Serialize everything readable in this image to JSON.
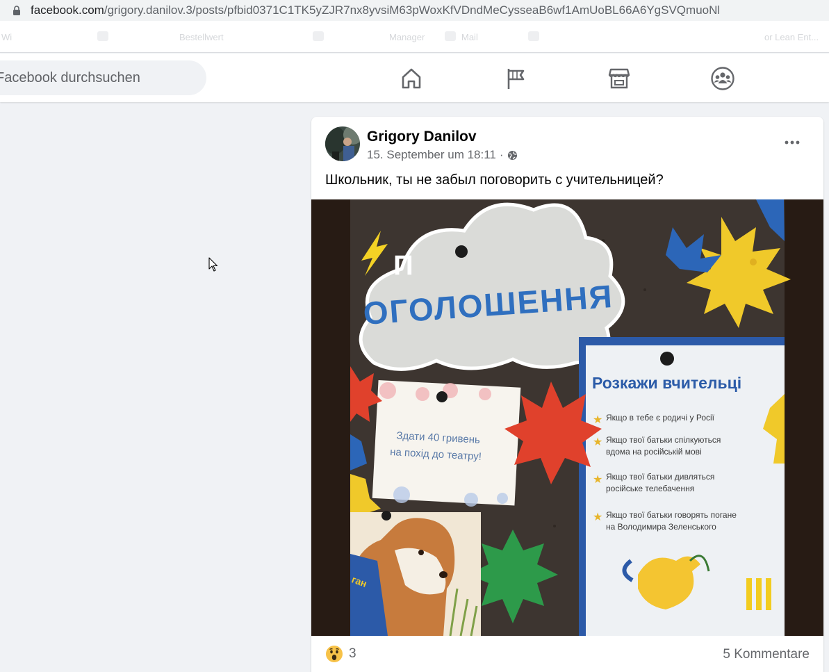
{
  "browser": {
    "url_host": "facebook.com",
    "url_path": "/grigory.danilov.3/posts/pfbid0371C1TK5yZJR7nx8yvsiM63pWoxKfVDndMeCysseaB6wf1AmUoBL66A6YgSVQmuoNl"
  },
  "bookmarks": [
    "Wi",
    "Bestellwert",
    "Manager",
    "Mail",
    "or Lean Ent..."
  ],
  "header": {
    "search_placeholder": "Facebook durchsuchen"
  },
  "post": {
    "author": "Grigory Danilov",
    "timestamp": "15. September um 18:11",
    "separator": "·",
    "text": "Школьник, ты не забыл поговорить с учительницей?",
    "image": {
      "logo": "П",
      "cloud_title": "ОГОЛОШЕННЯ",
      "note_line1": "Здати 40 гривень",
      "note_line2": "на похід до театру!",
      "poster_title": "Розкажи вчительці",
      "poster_items": [
        "Якщо в тебе є родичі у Росії",
        "Якщо твої батьки спілкуються",
        "вдома на російській мові",
        "Якщо твої батьки дивляться",
        "російське телебачення",
        "Якщо твої батьки говорять погане",
        "на Володимира Зеленського"
      ],
      "dog_label": "ган"
    },
    "reaction_count": "3",
    "comments": "5 Kommentare"
  },
  "colors": {
    "fb_blue": "#1877f2",
    "bg": "#f0f2f5",
    "secondary_text": "#65676b"
  }
}
